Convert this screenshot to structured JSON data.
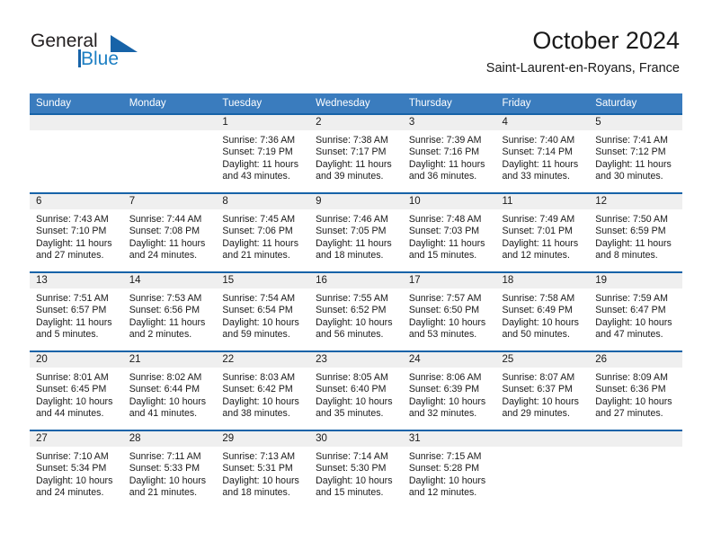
{
  "brand": {
    "name_part1": "General",
    "name_part2": "Blue",
    "accent_color": "#1763a8",
    "logo_icon": "triangle-flag-icon"
  },
  "header": {
    "month_title": "October 2024",
    "location": "Saint-Laurent-en-Royans, France"
  },
  "calendar": {
    "header_bg": "#3a7cbe",
    "row_border_color": "#1763a8",
    "daynum_bg": "#efefef",
    "weekday_headers": [
      "Sunday",
      "Monday",
      "Tuesday",
      "Wednesday",
      "Thursday",
      "Friday",
      "Saturday"
    ],
    "weeks": [
      [
        {
          "day": "",
          "sunrise": "",
          "sunset": "",
          "daylight_l1": "",
          "daylight_l2": ""
        },
        {
          "day": "",
          "sunrise": "",
          "sunset": "",
          "daylight_l1": "",
          "daylight_l2": ""
        },
        {
          "day": "1",
          "sunrise": "Sunrise: 7:36 AM",
          "sunset": "Sunset: 7:19 PM",
          "daylight_l1": "Daylight: 11 hours",
          "daylight_l2": "and 43 minutes."
        },
        {
          "day": "2",
          "sunrise": "Sunrise: 7:38 AM",
          "sunset": "Sunset: 7:17 PM",
          "daylight_l1": "Daylight: 11 hours",
          "daylight_l2": "and 39 minutes."
        },
        {
          "day": "3",
          "sunrise": "Sunrise: 7:39 AM",
          "sunset": "Sunset: 7:16 PM",
          "daylight_l1": "Daylight: 11 hours",
          "daylight_l2": "and 36 minutes."
        },
        {
          "day": "4",
          "sunrise": "Sunrise: 7:40 AM",
          "sunset": "Sunset: 7:14 PM",
          "daylight_l1": "Daylight: 11 hours",
          "daylight_l2": "and 33 minutes."
        },
        {
          "day": "5",
          "sunrise": "Sunrise: 7:41 AM",
          "sunset": "Sunset: 7:12 PM",
          "daylight_l1": "Daylight: 11 hours",
          "daylight_l2": "and 30 minutes."
        }
      ],
      [
        {
          "day": "6",
          "sunrise": "Sunrise: 7:43 AM",
          "sunset": "Sunset: 7:10 PM",
          "daylight_l1": "Daylight: 11 hours",
          "daylight_l2": "and 27 minutes."
        },
        {
          "day": "7",
          "sunrise": "Sunrise: 7:44 AM",
          "sunset": "Sunset: 7:08 PM",
          "daylight_l1": "Daylight: 11 hours",
          "daylight_l2": "and 24 minutes."
        },
        {
          "day": "8",
          "sunrise": "Sunrise: 7:45 AM",
          "sunset": "Sunset: 7:06 PM",
          "daylight_l1": "Daylight: 11 hours",
          "daylight_l2": "and 21 minutes."
        },
        {
          "day": "9",
          "sunrise": "Sunrise: 7:46 AM",
          "sunset": "Sunset: 7:05 PM",
          "daylight_l1": "Daylight: 11 hours",
          "daylight_l2": "and 18 minutes."
        },
        {
          "day": "10",
          "sunrise": "Sunrise: 7:48 AM",
          "sunset": "Sunset: 7:03 PM",
          "daylight_l1": "Daylight: 11 hours",
          "daylight_l2": "and 15 minutes."
        },
        {
          "day": "11",
          "sunrise": "Sunrise: 7:49 AM",
          "sunset": "Sunset: 7:01 PM",
          "daylight_l1": "Daylight: 11 hours",
          "daylight_l2": "and 12 minutes."
        },
        {
          "day": "12",
          "sunrise": "Sunrise: 7:50 AM",
          "sunset": "Sunset: 6:59 PM",
          "daylight_l1": "Daylight: 11 hours",
          "daylight_l2": "and 8 minutes."
        }
      ],
      [
        {
          "day": "13",
          "sunrise": "Sunrise: 7:51 AM",
          "sunset": "Sunset: 6:57 PM",
          "daylight_l1": "Daylight: 11 hours",
          "daylight_l2": "and 5 minutes."
        },
        {
          "day": "14",
          "sunrise": "Sunrise: 7:53 AM",
          "sunset": "Sunset: 6:56 PM",
          "daylight_l1": "Daylight: 11 hours",
          "daylight_l2": "and 2 minutes."
        },
        {
          "day": "15",
          "sunrise": "Sunrise: 7:54 AM",
          "sunset": "Sunset: 6:54 PM",
          "daylight_l1": "Daylight: 10 hours",
          "daylight_l2": "and 59 minutes."
        },
        {
          "day": "16",
          "sunrise": "Sunrise: 7:55 AM",
          "sunset": "Sunset: 6:52 PM",
          "daylight_l1": "Daylight: 10 hours",
          "daylight_l2": "and 56 minutes."
        },
        {
          "day": "17",
          "sunrise": "Sunrise: 7:57 AM",
          "sunset": "Sunset: 6:50 PM",
          "daylight_l1": "Daylight: 10 hours",
          "daylight_l2": "and 53 minutes."
        },
        {
          "day": "18",
          "sunrise": "Sunrise: 7:58 AM",
          "sunset": "Sunset: 6:49 PM",
          "daylight_l1": "Daylight: 10 hours",
          "daylight_l2": "and 50 minutes."
        },
        {
          "day": "19",
          "sunrise": "Sunrise: 7:59 AM",
          "sunset": "Sunset: 6:47 PM",
          "daylight_l1": "Daylight: 10 hours",
          "daylight_l2": "and 47 minutes."
        }
      ],
      [
        {
          "day": "20",
          "sunrise": "Sunrise: 8:01 AM",
          "sunset": "Sunset: 6:45 PM",
          "daylight_l1": "Daylight: 10 hours",
          "daylight_l2": "and 44 minutes."
        },
        {
          "day": "21",
          "sunrise": "Sunrise: 8:02 AM",
          "sunset": "Sunset: 6:44 PM",
          "daylight_l1": "Daylight: 10 hours",
          "daylight_l2": "and 41 minutes."
        },
        {
          "day": "22",
          "sunrise": "Sunrise: 8:03 AM",
          "sunset": "Sunset: 6:42 PM",
          "daylight_l1": "Daylight: 10 hours",
          "daylight_l2": "and 38 minutes."
        },
        {
          "day": "23",
          "sunrise": "Sunrise: 8:05 AM",
          "sunset": "Sunset: 6:40 PM",
          "daylight_l1": "Daylight: 10 hours",
          "daylight_l2": "and 35 minutes."
        },
        {
          "day": "24",
          "sunrise": "Sunrise: 8:06 AM",
          "sunset": "Sunset: 6:39 PM",
          "daylight_l1": "Daylight: 10 hours",
          "daylight_l2": "and 32 minutes."
        },
        {
          "day": "25",
          "sunrise": "Sunrise: 8:07 AM",
          "sunset": "Sunset: 6:37 PM",
          "daylight_l1": "Daylight: 10 hours",
          "daylight_l2": "and 29 minutes."
        },
        {
          "day": "26",
          "sunrise": "Sunrise: 8:09 AM",
          "sunset": "Sunset: 6:36 PM",
          "daylight_l1": "Daylight: 10 hours",
          "daylight_l2": "and 27 minutes."
        }
      ],
      [
        {
          "day": "27",
          "sunrise": "Sunrise: 7:10 AM",
          "sunset": "Sunset: 5:34 PM",
          "daylight_l1": "Daylight: 10 hours",
          "daylight_l2": "and 24 minutes."
        },
        {
          "day": "28",
          "sunrise": "Sunrise: 7:11 AM",
          "sunset": "Sunset: 5:33 PM",
          "daylight_l1": "Daylight: 10 hours",
          "daylight_l2": "and 21 minutes."
        },
        {
          "day": "29",
          "sunrise": "Sunrise: 7:13 AM",
          "sunset": "Sunset: 5:31 PM",
          "daylight_l1": "Daylight: 10 hours",
          "daylight_l2": "and 18 minutes."
        },
        {
          "day": "30",
          "sunrise": "Sunrise: 7:14 AM",
          "sunset": "Sunset: 5:30 PM",
          "daylight_l1": "Daylight: 10 hours",
          "daylight_l2": "and 15 minutes."
        },
        {
          "day": "31",
          "sunrise": "Sunrise: 7:15 AM",
          "sunset": "Sunset: 5:28 PM",
          "daylight_l1": "Daylight: 10 hours",
          "daylight_l2": "and 12 minutes."
        },
        {
          "day": "",
          "sunrise": "",
          "sunset": "",
          "daylight_l1": "",
          "daylight_l2": ""
        },
        {
          "day": "",
          "sunrise": "",
          "sunset": "",
          "daylight_l1": "",
          "daylight_l2": ""
        }
      ]
    ]
  }
}
